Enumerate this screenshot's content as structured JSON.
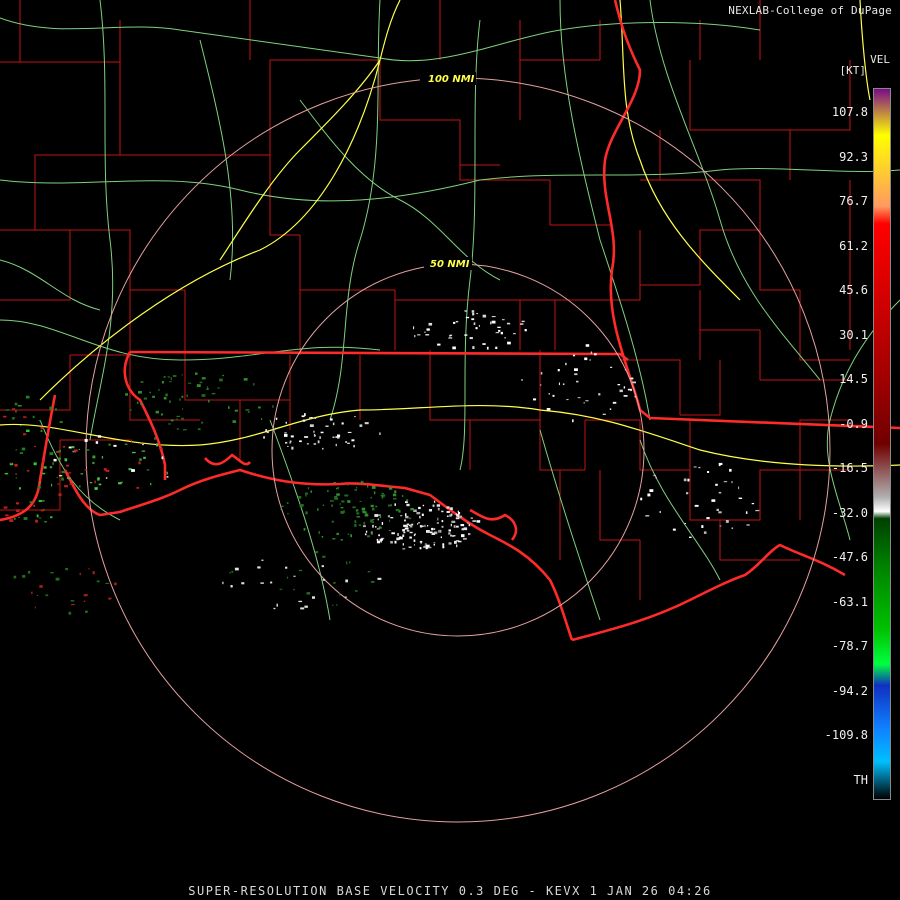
{
  "header": {
    "credit": "NEXLAB-College of DuPage",
    "product_short": "VEL",
    "units": "[KT]"
  },
  "footer": {
    "product_title": "SUPER-RESOLUTION BASE VELOCITY 0.3 DEG - KEVX 1 JAN 26 04:26"
  },
  "range_rings": [
    {
      "label": "100 NMI",
      "range_nmi": 100
    },
    {
      "label": "50 NMI",
      "range_nmi": 50
    }
  ],
  "legend": {
    "ticks": [
      "107.8",
      "92.3",
      "76.7",
      "61.2",
      "45.6",
      "30.1",
      "14.5",
      "-0.9",
      "-16.5",
      "-32.0",
      "-47.6",
      "-63.1",
      "-78.7",
      "-94.2",
      "-109.8",
      "TH"
    ],
    "colors": [
      "#7a0a8a",
      "#ffff00",
      "#ff9a60",
      "#ff0000",
      "#d00000",
      "#a00000",
      "#700000",
      "#b0b0b0",
      "#ffffff",
      "#004000",
      "#008000",
      "#00c000",
      "#00ff40",
      "#1030c0",
      "#1080ff",
      "#00c0ff",
      "#000000"
    ],
    "color_stops": [
      0,
      0.065,
      0.165,
      0.19,
      0.3,
      0.41,
      0.5,
      0.575,
      0.595,
      0.605,
      0.67,
      0.76,
      0.81,
      0.84,
      0.9,
      0.947,
      1.0
    ]
  },
  "colors": {
    "state_border": "#ff2a2a",
    "county_border": "#c41414",
    "highway": "#ffff4a",
    "road": "#7ed27e",
    "range_ring": "#e6a0a0"
  }
}
